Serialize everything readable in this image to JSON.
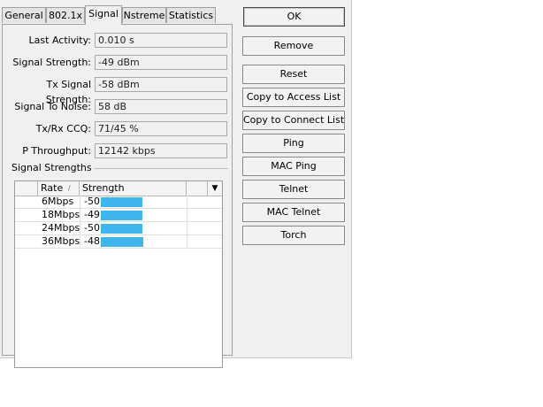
{
  "tabs": [
    "General",
    "802.1x",
    "Signal",
    "Nstreme",
    "Statistics"
  ],
  "active_tab": "Signal",
  "fields": [
    {
      "label": "Last Activity:",
      "value": "0.010 s"
    },
    {
      "label": "Signal Strength:",
      "value": "-49 dBm"
    },
    {
      "label": "Tx Signal Strength:",
      "value": "-58 dBm"
    },
    {
      "label": "Signal To Noise:",
      "value": "58 dB"
    },
    {
      "label": "Tx/Rx CCQ:",
      "value": "71/45 %"
    },
    {
      "label": "P Throughput:",
      "value": "12142 kbps"
    }
  ],
  "signal_group": {
    "title": "Signal Strengths",
    "columns": [
      "Rate",
      "Strength"
    ],
    "sort_indicator": "/",
    "column_menu_icon": "dropdown-arrow",
    "rows": [
      {
        "rate": "6Mbps",
        "strength": "-50"
      },
      {
        "rate": "18Mbps",
        "strength": "-49"
      },
      {
        "rate": "24Mbps",
        "strength": "-50"
      },
      {
        "rate": "36Mbps",
        "strength": "-48"
      }
    ],
    "bar_color": "#41b6ec"
  },
  "buttons": [
    "OK",
    "Remove",
    "Reset",
    "Copy to Access List",
    "Copy to Connect List",
    "Ping",
    "MAC Ping",
    "Telnet",
    "MAC Telnet",
    "Torch"
  ]
}
